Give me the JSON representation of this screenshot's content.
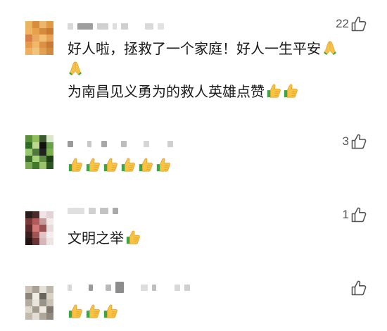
{
  "comments": [
    {
      "likes": "22",
      "lines": [
        "好人啦，拯救了一个家庭！好人一生平安"
      ],
      "line2": "为南昌见义勇为的救人英雄点赞",
      "emoji_thumbs_line2": 2,
      "emoji_pray_line1": 1,
      "emoji_pray_standalone": 1
    },
    {
      "likes": "3",
      "emoji_thumbs": 6
    },
    {
      "likes": "1",
      "text": "文明之举",
      "emoji_thumbs": 1
    },
    {
      "likes": "",
      "emoji_thumbs": 3
    }
  ],
  "icons": {
    "like": "thumbs-up-outline-icon",
    "thumb_emoji": "thumbs-up-emoji",
    "pray_emoji": "folded-hands-emoji"
  },
  "colors": {
    "emoji_yellow": "#f6c343",
    "emoji_orange": "#e8a12b",
    "cuff_green": "#3aa64a",
    "like_gray": "#555555",
    "placeholder_gray": "#cfcfcf"
  }
}
